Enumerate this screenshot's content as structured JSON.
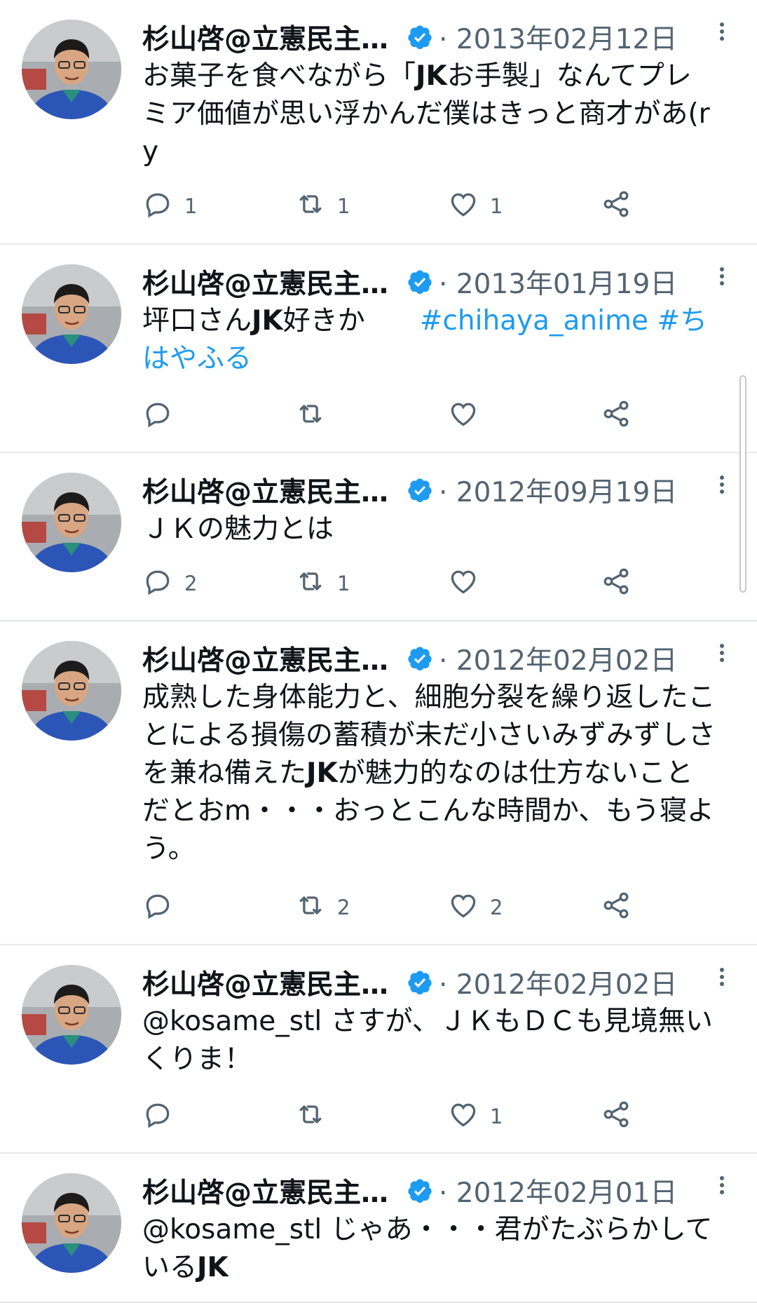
{
  "tweets": [
    {
      "author": "杉山啓@立憲民主…",
      "date": "· 2013年02月12日",
      "text_segments": [
        {
          "t": "お菓子を食べながら「",
          "k": "plain"
        },
        {
          "t": "JK",
          "k": "bold"
        },
        {
          "t": "お手製」なんてプレミア価値が思い浮かんだ僕はきっと商才があ(ry",
          "k": "plain"
        }
      ],
      "replies": "1",
      "retweets": "1",
      "likes": "1"
    },
    {
      "author": "杉山啓@立憲民主…",
      "date": "· 2013年01月19日",
      "text_segments": [
        {
          "t": "坪口さん",
          "k": "plain"
        },
        {
          "t": "JK",
          "k": "bold"
        },
        {
          "t": "好きか　　",
          "k": "plain"
        },
        {
          "t": "#chihaya_anime",
          "k": "tag"
        },
        {
          "t": " ",
          "k": "plain"
        },
        {
          "t": "#ちはやふる",
          "k": "tag"
        }
      ],
      "replies": "",
      "retweets": "",
      "likes": ""
    },
    {
      "author": "杉山啓@立憲民主…",
      "date": "· 2012年09月19日",
      "text_segments": [
        {
          "t": "ＪＫの魅力とは",
          "k": "plain"
        }
      ],
      "replies": "2",
      "retweets": "1",
      "likes": ""
    },
    {
      "author": "杉山啓@立憲民主…",
      "date": "· 2012年02月02日",
      "text_segments": [
        {
          "t": "成熟した身体能力と、細胞分裂を繰り返したことによる損傷の蓄積が未だ小さいみずみずしさを兼ね備えた",
          "k": "plain"
        },
        {
          "t": "JK",
          "k": "bold"
        },
        {
          "t": "が魅力的なのは仕方ないことだとおm・・・おっとこんな時間か、もう寝よう。",
          "k": "plain"
        }
      ],
      "replies": "",
      "retweets": "2",
      "likes": "2"
    },
    {
      "author": "杉山啓@立憲民主…",
      "date": "· 2012年02月02日",
      "text_segments": [
        {
          "t": "@kosame_stl さすが、ＪＫもＤＣも見境無いくりま！",
          "k": "plain"
        }
      ],
      "replies": "",
      "retweets": "",
      "likes": "1"
    },
    {
      "author": "杉山啓@立憲民主…",
      "date": "· 2012年02月01日",
      "text_segments": [
        {
          "t": "@kosame_stl じゃあ・・・君がたぶらかしている",
          "k": "plain"
        },
        {
          "t": "JK",
          "k": "bold"
        }
      ],
      "replies": "",
      "retweets": "",
      "likes": ""
    }
  ],
  "icons": {
    "verified": "verified-badge-icon",
    "reply": "reply-icon",
    "retweet": "retweet-icon",
    "like": "like-icon",
    "share": "share-icon",
    "more": "more-options-icon"
  },
  "colors": {
    "verified": "#1d9bf0",
    "hashtag": "#1d9bf0",
    "meta": "#536471",
    "divider": "#e6e9ec"
  }
}
